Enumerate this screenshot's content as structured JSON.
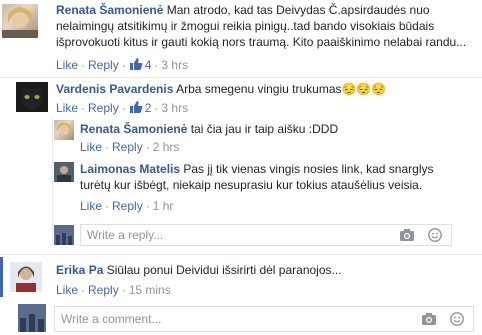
{
  "comments": [
    {
      "name": "Renata Šamonienė",
      "text_lines": [
        "Man atrodo, kad tas Deivydas Č.apsirdaudės nuo",
        "nelaimingų atsitikimų ir žmogui reikia pinigų..tad bando visokiais būdais",
        "išprovokuoti kitus ir gauti kokią nors traumą. Kito paaiškinimo nelabai randu..."
      ],
      "like": "Like",
      "reply": "Reply",
      "likes_count": "4",
      "time": "3 hrs"
    },
    {
      "name": "Vardenis Pavardenis",
      "text": "Arba smegenu vingiu trukumas😔😔😔",
      "like": "Like",
      "reply": "Reply",
      "likes_count": "2",
      "time": "3 hrs"
    },
    {
      "name": "Renata Šamonienė",
      "text": "tai čia jau ir taip aišku :DDD",
      "like": "Like",
      "reply": "Reply",
      "time": "2 hrs"
    },
    {
      "name": "Laimonas Matelis",
      "text_lines": [
        "Pas jį tik vienas vingis nosies link, kad snarglys",
        "turėtų kur išbėgt, niekaip nesuprasiu kur tokius atаušėlius veisia."
      ],
      "like": "Like",
      "reply": "Reply",
      "time": "1 hr"
    },
    {
      "name": "Erika Pa",
      "text": "Siūlau ponui Deividui išsirirti dėl paranojos...",
      "like": "Like",
      "reply": "Reply",
      "time": "15 mins"
    }
  ],
  "reply_box": {
    "placeholder": "Write a reply..."
  },
  "comment_box": {
    "placeholder": "Write a comment..."
  },
  "separator": "·",
  "colors": {
    "link": "#4267b2",
    "name": "#365899",
    "muted": "#90949c",
    "border": "#dddfe2"
  }
}
